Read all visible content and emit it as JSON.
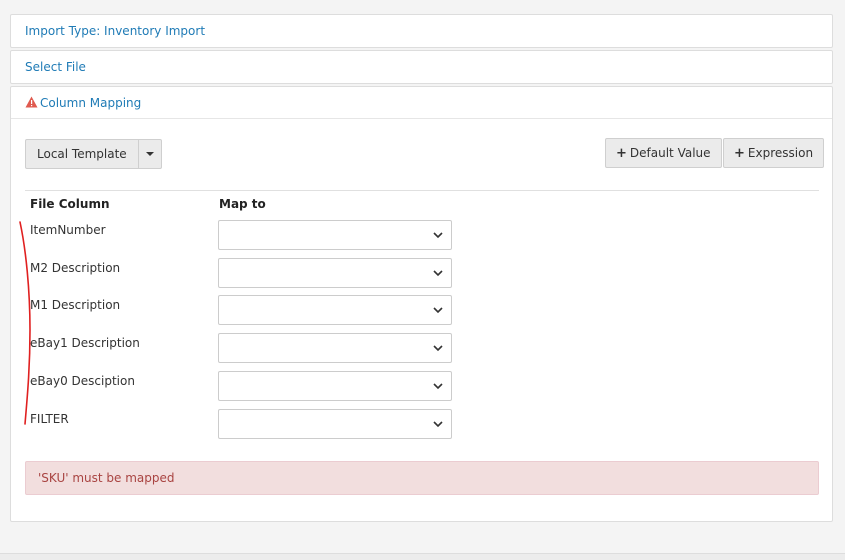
{
  "sections": {
    "import_type": "Import Type: Inventory Import",
    "select_file": "Select File",
    "column_mapping": "Column Mapping"
  },
  "toolbar": {
    "template_label": "Local Template",
    "default_value_label": "Default Value",
    "expression_label": "Expression"
  },
  "table": {
    "headers": [
      "File Column",
      "Map to"
    ],
    "rows": [
      {
        "file_column": "ItemNumber",
        "map_to": ""
      },
      {
        "file_column": "M2 Description",
        "map_to": ""
      },
      {
        "file_column": "M1 Description",
        "map_to": ""
      },
      {
        "file_column": "eBay1 Description",
        "map_to": ""
      },
      {
        "file_column": "eBay0 Desciption",
        "map_to": ""
      },
      {
        "file_column": "FILTER",
        "map_to": ""
      }
    ]
  },
  "alert": {
    "message": "'SKU' must be mapped"
  },
  "colors": {
    "link": "#1f7bb6",
    "warning": "#e05a4f",
    "alert_bg": "#f2dede",
    "alert_text": "#a94442",
    "annotation": "#e02020"
  },
  "icons": {
    "warning": "warning-triangle-icon",
    "plus": "plus-icon",
    "caret": "caret-down-icon",
    "chevron": "chevron-down-icon"
  }
}
